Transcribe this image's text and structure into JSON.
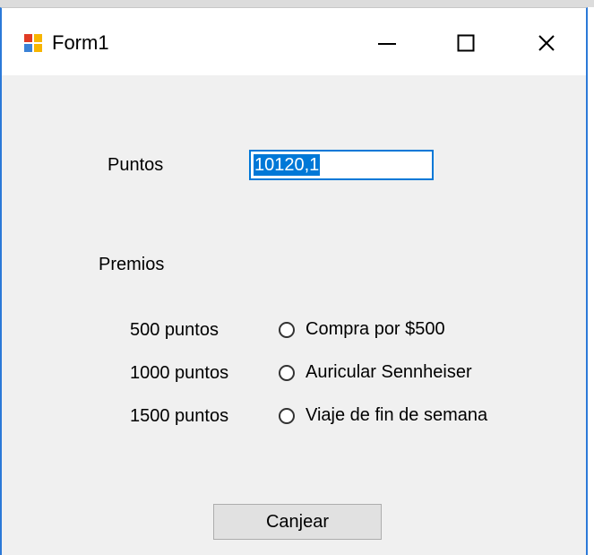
{
  "window": {
    "title": "Form1",
    "controls": {
      "minimize": "minimize",
      "maximize": "maximize",
      "close": "close"
    }
  },
  "form": {
    "points_label": "Puntos",
    "points_value": "10120,1",
    "prizes_label": "Premios",
    "options": [
      {
        "points": "500 puntos",
        "prize": "Compra por $500",
        "selected": false
      },
      {
        "points": "1000 puntos",
        "prize": "Auricular Sennheiser",
        "selected": false
      },
      {
        "points": "1500 puntos",
        "prize": "Viaje de fin de semana",
        "selected": false
      }
    ],
    "redeem_label": "Canjear"
  },
  "colors": {
    "accent": "#0078d7",
    "border": "#2b79d8"
  }
}
